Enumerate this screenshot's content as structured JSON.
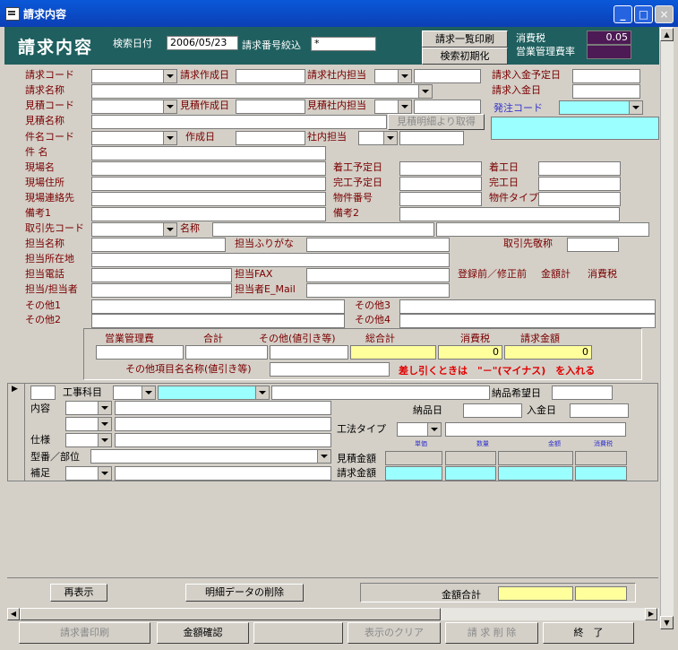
{
  "window": {
    "title": "請求内容"
  },
  "header": {
    "title": "請求内容",
    "search_date_label": "検索日付",
    "search_date": "2006/05/23",
    "number_filter_label": "請求番号絞込",
    "number_filter": "*",
    "print_list_btn": "請求一覧印刷",
    "reset_search_btn": "検索初期化",
    "tax_label": "消費税",
    "tax_rate": "0.05",
    "mgmt_label": "営業管理費率",
    "mgmt_rate": ""
  },
  "form": {
    "billing_code": "請求コード",
    "billing_created": "請求作成日",
    "billing_staff": "請求社内担当",
    "billing_name": "請求名称",
    "estimate_code": "見積コード",
    "estimate_created": "見積作成日",
    "estimate_staff": "見積社内担当",
    "estimate_name": "見積名称",
    "fetch_from_estimate": "見積明細より取得",
    "payment_due": "請求入金予定日",
    "payment_date": "請求入金日",
    "order_code": "発注コード",
    "subject_code": "件名コード",
    "created": "作成日",
    "internal_staff": "社内担当",
    "subject": "件 名",
    "site_name": "現場名",
    "site_address": "現場住所",
    "site_contact": "現場連絡先",
    "note1": "備考1",
    "note2": "備考2",
    "start_plan": "着工予定日",
    "start_date": "着工日",
    "finish_plan": "完工予定日",
    "finish_date": "完工日",
    "property_no": "物件番号",
    "property_type": "物件タイプ",
    "client_code": "取引先コード",
    "name": "名称",
    "contact_name": "担当名称",
    "contact_kana": "担当ふりがな",
    "honorific": "取引先敬称",
    "contact_address": "担当所在地",
    "contact_phone": "担当電話",
    "contact_fax": "担当FAX",
    "contact_person": "担当/担当者",
    "contact_email": "担当者E_Mail",
    "pre_reg_label": "登録前／修正前",
    "total_label": "金額計",
    "tax_label": "消費税",
    "other1": "その他1",
    "other2": "その他2",
    "other3": "その他3",
    "other4": "その他4"
  },
  "totals": {
    "mgmt_fee": "営業管理費",
    "sum": "合計",
    "other": "その他(値引き等)",
    "grand_total": "総合計",
    "tax": "消費税",
    "billing_amount": "請求金額",
    "tax_value": "0",
    "billing_value": "0",
    "other_item_label": "その他項目名名称(値引き等)",
    "discount_note": "差し引くときは　\"－\"(マイナス)　を入れる"
  },
  "detail": {
    "work_category": "工事科目",
    "desired_delivery": "納品希望日",
    "content": "内容",
    "delivery_date": "納品日",
    "payment_date": "入金日",
    "method_type": "工法タイプ",
    "spec": "仕様",
    "model": "型番／部位",
    "supplement": "補足",
    "unit_price": "単価",
    "quantity": "数量",
    "amount": "金額",
    "tax": "消費税",
    "estimate_amount": "見積金額",
    "billing_amount": "請求金額"
  },
  "footer": {
    "redisplay": "再表示",
    "delete_details": "明細データの削除",
    "amount_total": "金額合計"
  },
  "bottom_buttons": {
    "print_invoice": "請求書印刷",
    "confirm_amount": "金額確認",
    "blank": "",
    "clear_display": "表示のクリア",
    "delete_billing": "請 求 削 除",
    "exit": "終　了"
  }
}
